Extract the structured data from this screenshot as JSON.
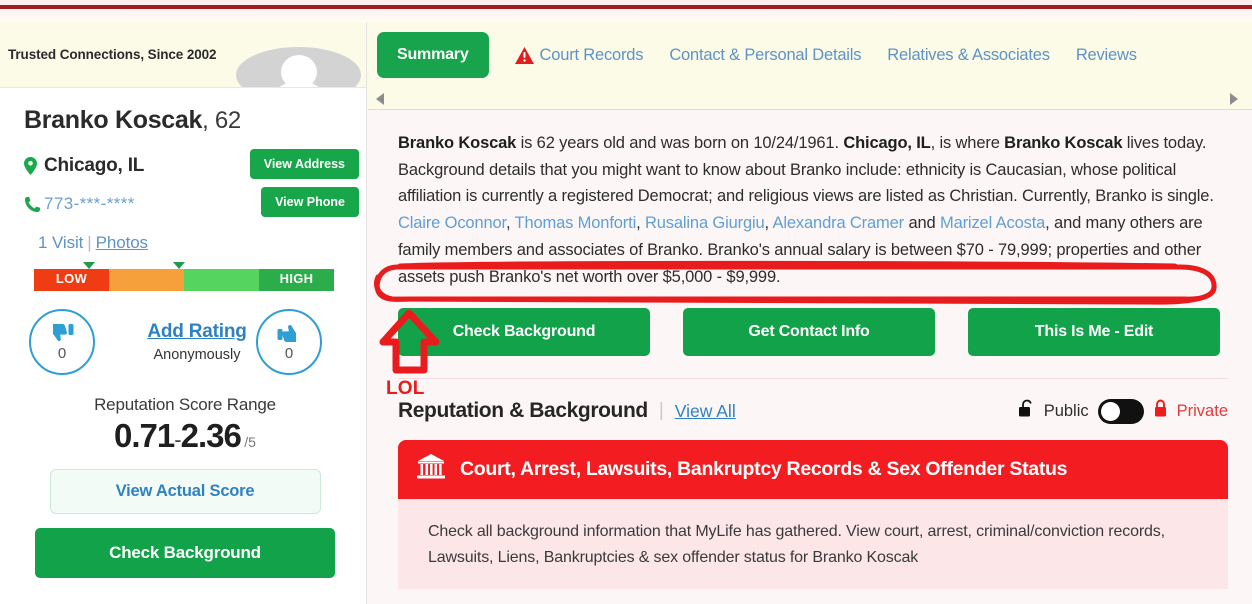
{
  "left": {
    "tagline": "Trusted Connections, Since 2002",
    "avatar_icon": "person-avatar-icon",
    "person_name": "Branko Koscak",
    "person_name_comma": ",",
    "person_age": "62",
    "location_icon": "map-pin-icon",
    "location": "Chicago, IL",
    "view_address_label": "View Address",
    "phone_icon": "phone-icon",
    "phone": "773-***-****",
    "view_phone_label": "View Phone",
    "visits": "1 Visit",
    "visits_sep": "|",
    "photos_label": "Photos",
    "rating_bar": {
      "low_label": "LOW",
      "high_label": "HIGH",
      "colors": [
        "#f03c12",
        "#f6a03c",
        "#55d45f",
        "#2aad4a"
      ],
      "segment_widths": [
        75,
        75,
        75,
        75
      ],
      "marker_positions": [
        55,
        145
      ]
    },
    "thumb_down_icon": "thumb-down-icon",
    "thumb_down_count": "0",
    "thumb_up_icon": "thumb-up-icon",
    "thumb_up_count": "0",
    "add_rating_label": "Add Rating",
    "anonymously_label": "Anonymously",
    "score_title": "Reputation Score Range",
    "score_min": "0.71",
    "score_dash": "-",
    "score_max": "2.36",
    "score_of": "/5",
    "view_actual_score_label": "View Actual Score",
    "check_background_label": "Check Background"
  },
  "tabs": [
    {
      "label": "Summary",
      "active": true,
      "icon": null
    },
    {
      "label": "Court Records",
      "active": false,
      "icon": "warning-triangle-icon"
    },
    {
      "label": "Contact & Personal Details",
      "active": false,
      "icon": null
    },
    {
      "label": "Relatives & Associates",
      "active": false,
      "icon": null
    },
    {
      "label": "Reviews",
      "active": false,
      "icon": null
    }
  ],
  "main": {
    "bio": {
      "p1_name": "Branko Koscak",
      "p1_a": " is 62 years old and was born on 10/24/1961. ",
      "p1_city": "Chicago, IL",
      "p1_b": ", is where ",
      "p1_name2": "Branko Koscak",
      "p1_c": " lives today. Background details that you might want to know about Branko include: ethnicity is Caucasian, whose political affiliation is currently a registered Democrat; and religious views are listed as Christian. Currently, Branko is single. ",
      "rel1": "Claire Oconnor",
      "rel_sep1": ", ",
      "rel2": "Thomas Monforti",
      "rel_sep2": ", ",
      "rel3": "Rusalina Giurgiu",
      "rel_sep3": ", ",
      "rel4": "Alexandra Cramer",
      "rel_and": " and ",
      "rel5": "Marizel Acosta",
      "p1_d": ", and many others are family members and associates of Branko. Branko's annual salary is between $70 - 79,999; properties and other assets push Branko's net worth over $5,000 - $9,999."
    },
    "cta_buttons": [
      {
        "label": "Check Background"
      },
      {
        "label": "Get Contact Info"
      },
      {
        "label": "This Is Me - Edit"
      }
    ],
    "reputation": {
      "title": "Reputation & Background",
      "divider": "|",
      "view_all_label": "View All",
      "public_icon": "unlock-icon",
      "public_label": "Public",
      "toggle_state": "public",
      "private_icon": "lock-icon",
      "private_label": "Private"
    },
    "red_card": {
      "icon": "courthouse-icon",
      "title": "Court, Arrest, Lawsuits, Bankruptcy Records & Sex Offender Status",
      "body": "Check all background information that MyLife has gathered. View court, arrest, criminal/conviction records, Lawsuits, Liens, Bankruptcies & sex offender status for Branko Koscak"
    }
  },
  "annotations": {
    "circle_icon": "red-ellipse-annotation",
    "arrow_icon": "red-up-arrow-annotation",
    "lol_text": "LOL",
    "color": "#e81c1c"
  }
}
